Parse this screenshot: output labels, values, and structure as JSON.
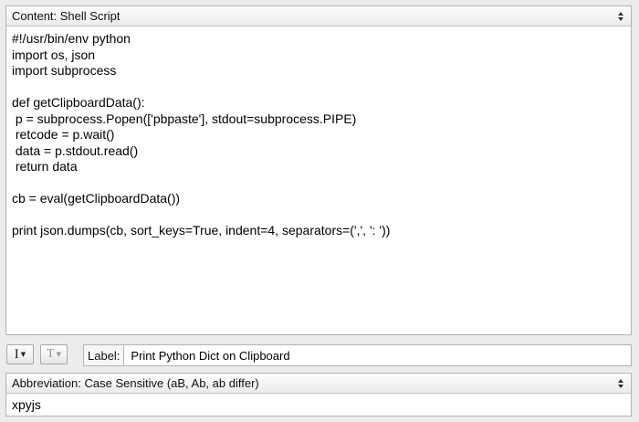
{
  "content": {
    "type_label": "Content: Shell Script",
    "code_lines": [
      "#!/usr/bin/env python",
      "import os, json",
      "import subprocess",
      "",
      "def getClipboardData():",
      " p = subprocess.Popen(['pbpaste'], stdout=subprocess.PIPE)",
      " retcode = p.wait()",
      " data = p.stdout.read()",
      " return data",
      "",
      "cb = eval(getClipboardData())",
      "",
      "print json.dumps(cb, sort_keys=True, indent=4, separators=(',', ': '))"
    ]
  },
  "toolbar": {
    "text_tool_icon": "I",
    "format_tool_icon": "T",
    "label_tag": "Label:",
    "label_value": "Print Python Dict on Clipboard"
  },
  "abbreviation": {
    "mode_label": "Abbreviation: Case Sensitive (aB, Ab, ab differ)",
    "value": "xpyjs"
  },
  "icons": {
    "popup_arrows": "updown-arrows-icon",
    "caret": "caret-down-icon"
  }
}
